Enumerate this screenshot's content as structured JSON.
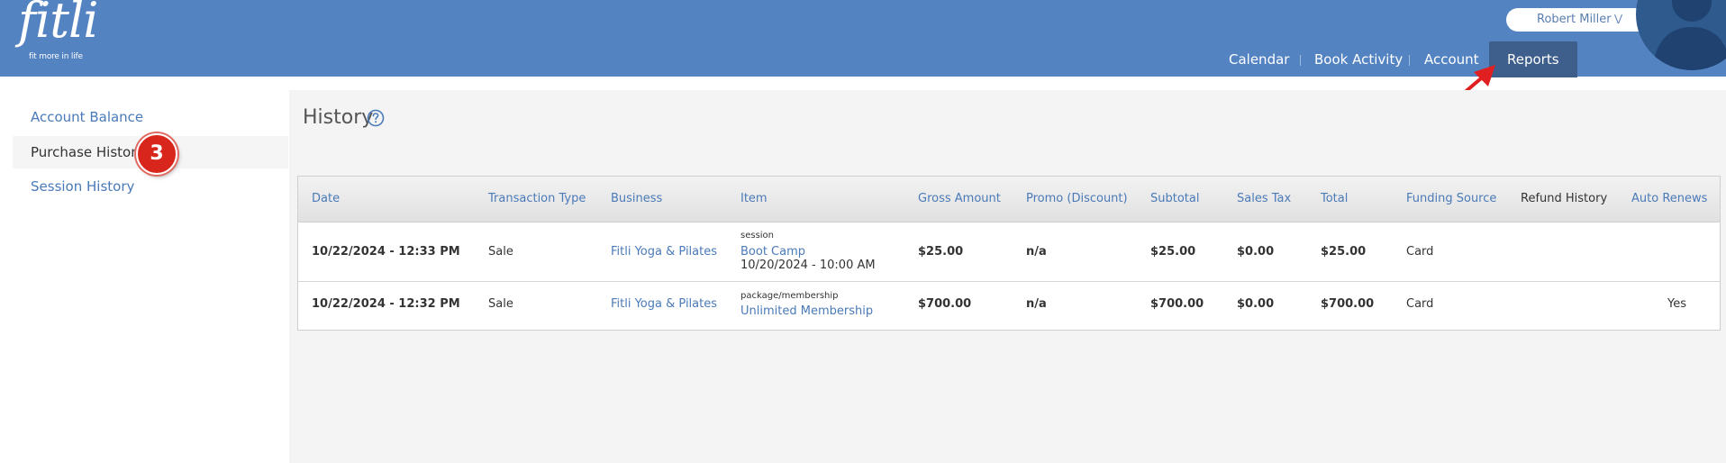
{
  "app": {
    "logo_text": "fitli",
    "logo_tagline": "fit more in life",
    "user_name": "Robert Miller",
    "user_menu_icon": "double-chevron-down-icon",
    "avatar_icon": "user-silhouette-icon"
  },
  "nav": {
    "items": [
      "Calendar",
      "Book Activity",
      "Account",
      "Reports"
    ],
    "active": "Reports"
  },
  "annotations": {
    "step_badge": "3",
    "arrow_color": "#e02020"
  },
  "sidebar": {
    "items": [
      "Account Balance",
      "Purchase History",
      "Session History"
    ],
    "active": "Purchase History"
  },
  "main": {
    "title": "History",
    "help_icon": "question-circle-icon"
  },
  "table": {
    "columns": [
      "Date",
      "Transaction Type",
      "Business",
      "Item",
      "Gross Amount",
      "Promo (Discount)",
      "Subtotal",
      "Sales Tax",
      "Total",
      "Funding Source",
      "Refund History",
      "Auto Renews"
    ],
    "rows": [
      {
        "date": "10/22/2024 - 12:33 PM",
        "transaction_type": "Sale",
        "business": "Fitli Yoga & Pilates",
        "item_type": "session",
        "item_name": "Boot Camp",
        "item_datetime": "10/20/2024 - 10:00 AM",
        "gross_amount": "$25.00",
        "promo": "n/a",
        "subtotal": "$25.00",
        "sales_tax": "$0.00",
        "total": "$25.00",
        "funding_source": "Card",
        "refund_history": "",
        "auto_renews": ""
      },
      {
        "date": "10/22/2024 - 12:32 PM",
        "transaction_type": "Sale",
        "business": "Fitli Yoga & Pilates",
        "item_type": "package/membership",
        "item_name": "Unlimited Membership",
        "item_datetime": "",
        "gross_amount": "$700.00",
        "promo": "n/a",
        "subtotal": "$700.00",
        "sales_tax": "$0.00",
        "total": "$700.00",
        "funding_source": "Card",
        "refund_history": "",
        "auto_renews": "Yes"
      }
    ]
  },
  "colors": {
    "header": "#5483c2",
    "active_tab": "#3e5f8c",
    "link": "#4a7ab8",
    "badge": "#d9261c"
  }
}
